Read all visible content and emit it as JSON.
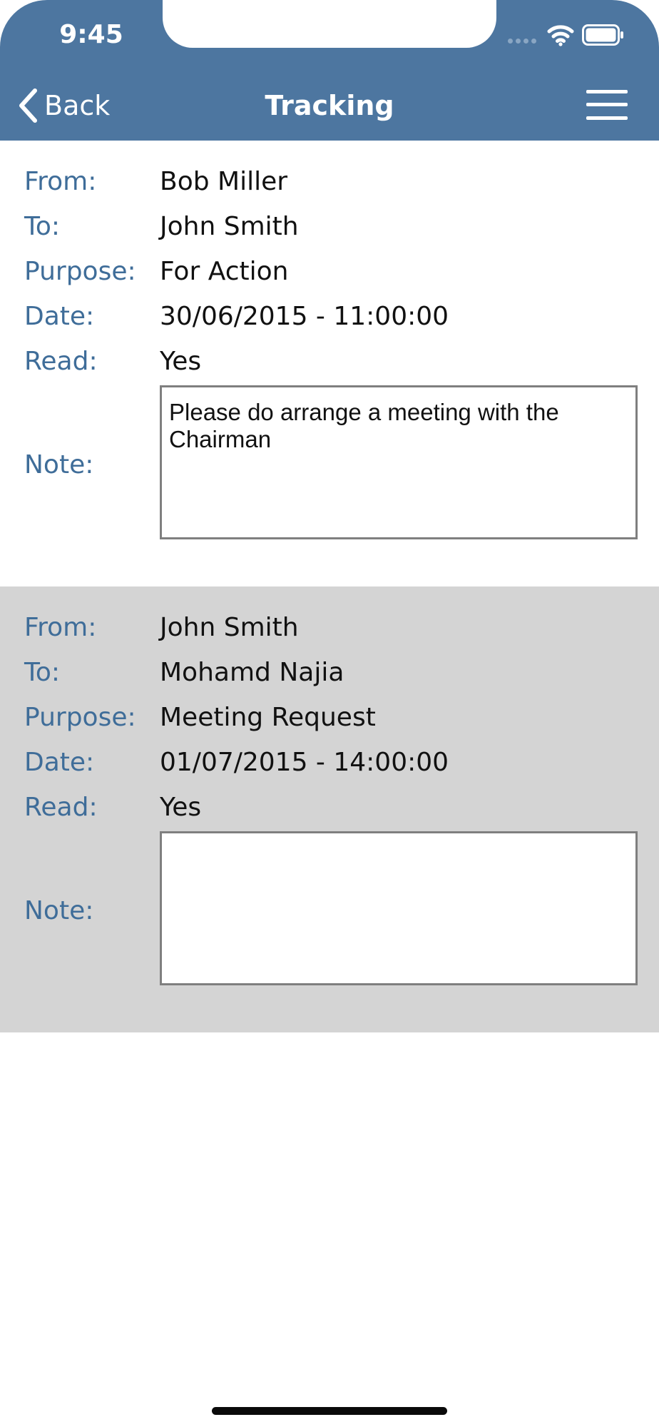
{
  "status_bar": {
    "time": "9:45"
  },
  "nav": {
    "back_label": "Back",
    "title": "Tracking",
    "menu_icon": "hamburger-menu-icon",
    "back_icon": "chevron-left-icon"
  },
  "labels": {
    "from": "From:",
    "to": "To:",
    "purpose": "Purpose:",
    "date": "Date:",
    "read": "Read:",
    "note": "Note:"
  },
  "records": [
    {
      "from": "Bob Miller",
      "to": "John Smith",
      "purpose": "For Action",
      "date": "30/06/2015 - 11:00:00",
      "read": "Yes",
      "note": "Please do arrange a meeting with the Chairman"
    },
    {
      "from": "John Smith",
      "to": "Mohamd Najia",
      "purpose": "Meeting Request",
      "date": "01/07/2015 - 14:00:00",
      "read": "Yes",
      "note": ""
    }
  ],
  "colors": {
    "header_bg": "#4d76a0",
    "label_text": "#3f6d99",
    "alt_card_bg": "#d4d4d4"
  }
}
